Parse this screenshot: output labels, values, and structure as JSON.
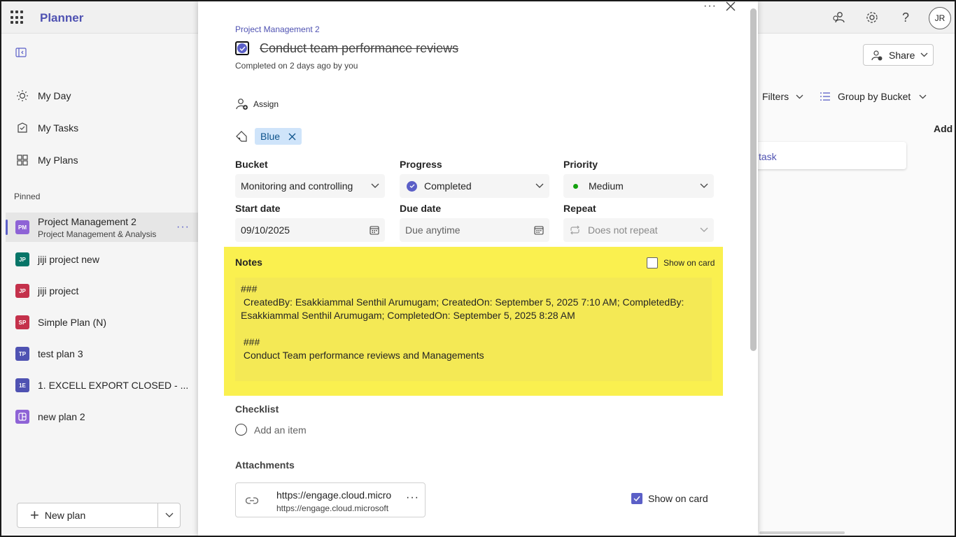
{
  "app": {
    "name": "Planner"
  },
  "header": {
    "avatar_initials": "JR"
  },
  "leftnav": {
    "items": [
      {
        "label": "My Day",
        "icon": "sun-icon"
      },
      {
        "label": "My Tasks",
        "icon": "task-check-icon"
      },
      {
        "label": "My Plans",
        "icon": "grid-icon"
      }
    ],
    "pinned_label": "Pinned",
    "plans": [
      {
        "badge": "PM",
        "label": "Project Management 2",
        "sub": "Project Management & Analysis",
        "color": "#8e63d6"
      },
      {
        "badge": "JP",
        "label": "jiji project new",
        "color": "#077568"
      },
      {
        "badge": "JP",
        "label": "jiji project",
        "color": "#c4314b"
      },
      {
        "badge": "SP",
        "label": "Simple Plan (N)",
        "color": "#c4314b"
      },
      {
        "badge": "TP",
        "label": "test plan 3",
        "color": "#4f52b2"
      },
      {
        "badge": "1E",
        "label": "1. EXCELL EXPORT CLOSED - ...",
        "color": "#4f52b2"
      },
      {
        "badge": "",
        "label": "new plan 2",
        "color": "#8e63d6"
      }
    ],
    "new_plan": "New plan"
  },
  "background": {
    "share": "Share",
    "filters": "Filters",
    "group_by": "Group by Bucket",
    "add": "Add",
    "task_link": "task"
  },
  "task": {
    "plan_name": "Project Management 2",
    "title": "Conduct team performance reviews",
    "completed_text": "Completed on 2 days ago by you",
    "assign": "Assign",
    "label_chip": "Blue",
    "bucket": {
      "label": "Bucket",
      "value": "Monitoring and controlling"
    },
    "progress": {
      "label": "Progress",
      "value": "Completed"
    },
    "priority": {
      "label": "Priority",
      "value": "Medium"
    },
    "start_date": {
      "label": "Start date",
      "value": "09/10/2025"
    },
    "due_date": {
      "label": "Due date",
      "placeholder": "Due anytime"
    },
    "repeat": {
      "label": "Repeat",
      "value": "Does not repeat"
    },
    "notes": {
      "label": "Notes",
      "show_on_card": "Show on card",
      "text": "###\n CreatedBy: Esakkiammal Senthil Arumugam; CreatedOn: September 5, 2025 7:10 AM; CompletedBy: Esakkiammal Senthil Arumugam; CompletedOn: September 5, 2025 8:28 AM\n\n ###\n Conduct Team performance reviews and Managements"
    },
    "checklist": {
      "label": "Checklist",
      "add_item": "Add an item"
    },
    "attachments": {
      "label": "Attachments",
      "title": "https://engage.cloud.microsoft",
      "url": "https://engage.cloud.microsoft",
      "show_on_card": "Show on card"
    }
  }
}
